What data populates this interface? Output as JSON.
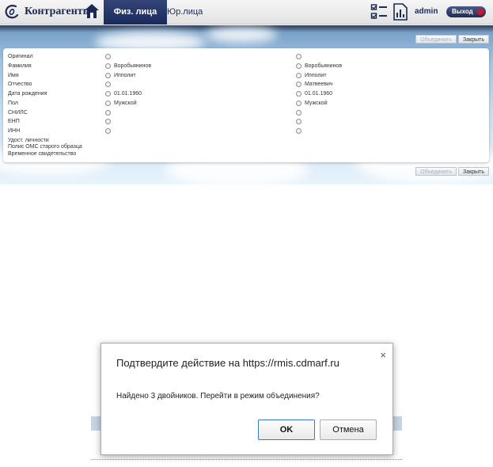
{
  "app": {
    "title": "Контрагенты",
    "tabs": [
      {
        "label": "Физ. лица",
        "active": true
      },
      {
        "label": "Юр.лица",
        "active": false
      }
    ],
    "user": "admin",
    "logout_label": "Выход",
    "brand_color": "#1b2a55",
    "logout_dot_color": "#d3142b"
  },
  "toolbar": {
    "merge_label": "Объединить",
    "close_label": "Закрыть"
  },
  "merge": {
    "fields": [
      "Оригинал",
      "Фамилия",
      "Имя",
      "Отчество",
      "Дата рождения",
      "Пол",
      "СНИЛС",
      "ЕНП",
      "ИНН",
      "Удост. личности",
      "Полис ОМС старого образца",
      "Временное свидетельство"
    ],
    "records": [
      {
        "values": [
          "",
          "Воробьянинов",
          "Ипполит",
          "",
          "01.01.1960",
          "Мужской",
          "",
          "",
          ""
        ]
      },
      {
        "values": [
          "",
          "Воробьянинов",
          "Ипполит",
          "Матвеевич",
          "01.01.1960",
          "Мужской",
          "",
          "",
          ""
        ]
      }
    ]
  },
  "dialog": {
    "title": "Подтвердите действие на https://rmis.cdmarf.ru",
    "close_icon": "×",
    "message": "Найдено 3 двойников. Перейти в режим объединения?",
    "ok_label": "OK",
    "cancel_label": "Отмена"
  }
}
